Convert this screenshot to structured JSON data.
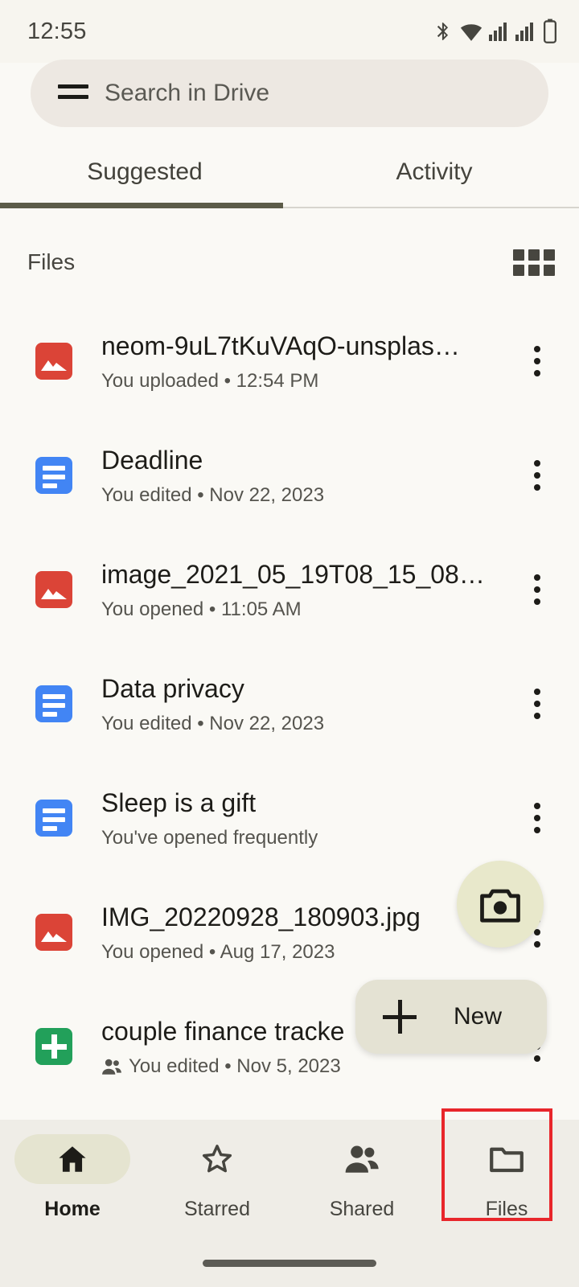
{
  "status_bar": {
    "time": "12:55",
    "icons": [
      "bluetooth-icon",
      "wifi-icon",
      "signal-icon",
      "signal-icon",
      "battery-icon"
    ]
  },
  "search": {
    "menu_icon": "hamburger-menu-icon",
    "placeholder": "Search in Drive"
  },
  "tabs": [
    {
      "label": "Suggested",
      "active": true
    },
    {
      "label": "Activity",
      "active": false
    }
  ],
  "section": {
    "title": "Files",
    "view_toggle_icon": "grid-view-icon"
  },
  "files": [
    {
      "name": "neom-9uL7tKuVAqO-unsplas…",
      "meta": "You uploaded • 12:54 PM",
      "icon": "image-file-icon",
      "icon_type": "image",
      "shared": false
    },
    {
      "name": "Deadline",
      "meta": "You edited • Nov 22, 2023",
      "icon": "google-docs-icon",
      "icon_type": "doc",
      "shared": false
    },
    {
      "name": "image_2021_05_19T08_15_08…",
      "meta": "You opened • 11:05 AM",
      "icon": "image-file-icon",
      "icon_type": "image",
      "shared": false
    },
    {
      "name": "Data privacy",
      "meta": "You edited • Nov 22, 2023",
      "icon": "google-docs-icon",
      "icon_type": "doc",
      "shared": false
    },
    {
      "name": "Sleep is a gift",
      "meta": "You've opened frequently",
      "icon": "google-docs-icon",
      "icon_type": "doc",
      "shared": false
    },
    {
      "name": "IMG_20220928_180903.jpg",
      "meta": "You opened • Aug 17, 2023",
      "icon": "image-file-icon",
      "icon_type": "image",
      "shared": false
    },
    {
      "name": "couple finance tracke",
      "meta": "You edited • Nov 5, 2023",
      "icon": "google-sheets-icon",
      "icon_type": "sheet",
      "shared": true
    }
  ],
  "fabs": {
    "camera_icon": "camera-icon",
    "new_label": "New",
    "new_icon": "plus-icon"
  },
  "bottom_nav": [
    {
      "label": "Home",
      "icon": "home-icon",
      "active": true
    },
    {
      "label": "Starred",
      "icon": "star-icon",
      "active": false
    },
    {
      "label": "Shared",
      "icon": "people-icon",
      "active": false
    },
    {
      "label": "Files",
      "icon": "folder-icon",
      "active": false
    }
  ],
  "annotation": {
    "target": "Files",
    "color": "#E8262B"
  },
  "colors": {
    "background": "#FAF9F5",
    "nav_background": "#EFEDE7",
    "accent": "#5C5C49",
    "pill": "#E5E4D0",
    "fab_camera": "#E8E8CB",
    "fab_new": "#E4E2D3",
    "image_icon": "#DB4437",
    "doc_icon": "#4285F4",
    "sheet_icon": "#22A05A"
  }
}
